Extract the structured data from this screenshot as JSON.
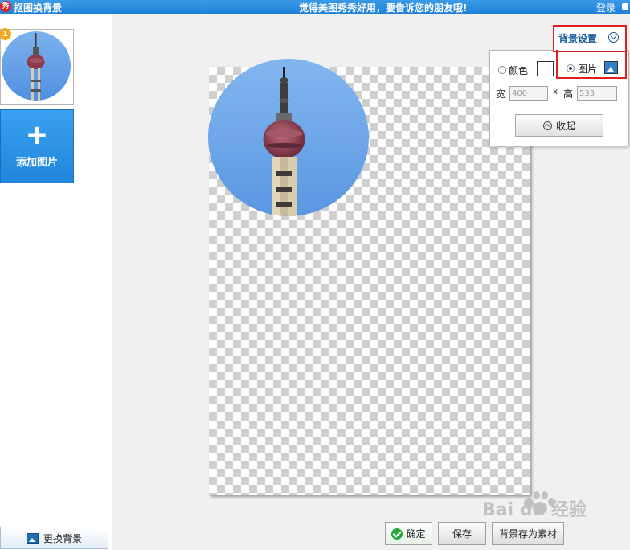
{
  "titlebar": {
    "app_icon_char": "秀",
    "title": "抠图换背景",
    "slogan": "觉得美图秀秀好用，要告诉您的朋友哦!",
    "login": "登录"
  },
  "sidebar": {
    "thumbnail_badge": "1",
    "add_image_icon": "+",
    "add_image_label": "添加图片",
    "change_background_label": "更换背景"
  },
  "bg_settings": {
    "title": "背景设置",
    "color_option": "颜色",
    "image_option": "图片",
    "selected": "image",
    "width_label": "宽",
    "height_label": "高",
    "times": "x",
    "width_value": "400",
    "height_value": "533",
    "collapse_label": "收起"
  },
  "actions": {
    "confirm_label": "确定",
    "save_label": "保存",
    "save_as_material_label": "背景存为素材"
  },
  "watermark": {
    "text": "Bai du 经验"
  },
  "colors": {
    "titlebar": "#1f7fd6",
    "highlight": "#e02020",
    "accent_blue": "#1a5a9a",
    "confirm_green": "#2aa640"
  }
}
